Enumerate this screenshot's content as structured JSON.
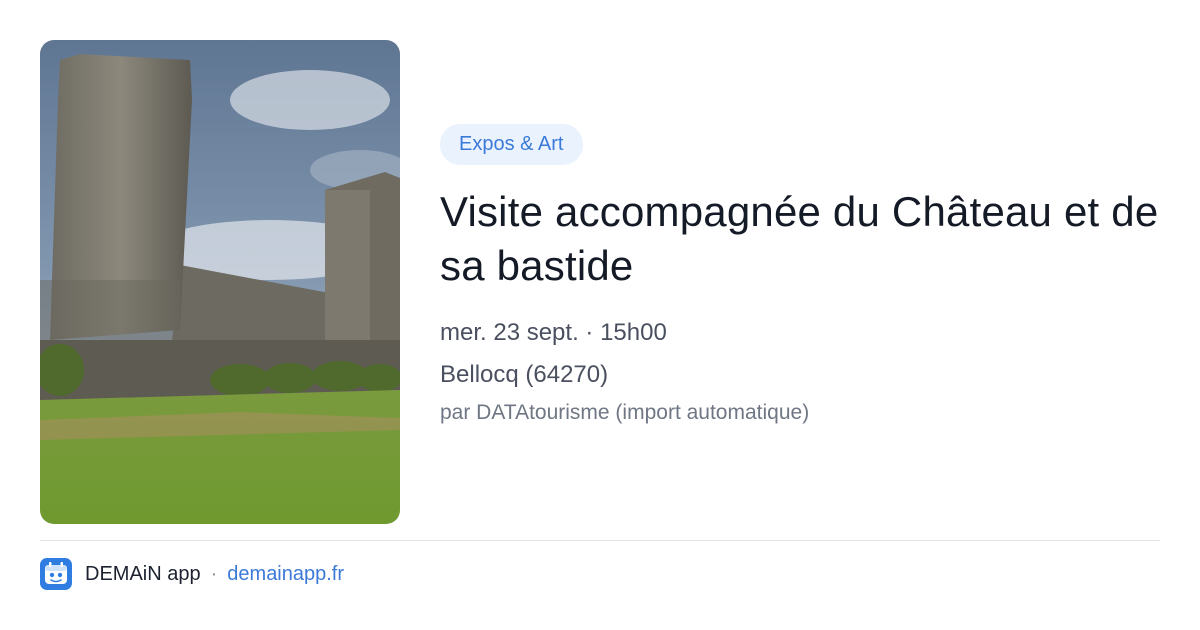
{
  "event": {
    "image_alt": "Château de Bellocq avec tour ronde et vignes",
    "category": "Expos & Art",
    "title": "Visite accompagnée du Château et de sa bastide",
    "date_time": "mer. 23 sept. · 15h00",
    "location": "Bellocq (64270)",
    "source": "par DATAtourisme (import automatique)"
  },
  "footer": {
    "app_name": "DEMAiN app",
    "separator": "·",
    "link": "demainapp.fr",
    "logo_icon": "demain-app-logo-icon"
  },
  "colors": {
    "accent": "#3b7ad8",
    "pill_background": "#eaf2fd",
    "title": "#141a26",
    "meta": "#4a5060",
    "source": "#6f7684"
  }
}
